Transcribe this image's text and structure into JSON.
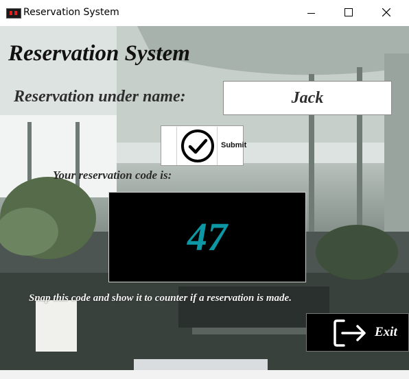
{
  "window": {
    "title": "Reservation System",
    "minimize_icon": "minimize-icon",
    "maximize_icon": "maximize-icon",
    "close_icon": "close-icon"
  },
  "form": {
    "heading": "Reservation System",
    "name_label": "Reservation under name:",
    "name_value": "Jack",
    "submit_label": "Submit",
    "submit_icon": "check-circle-icon",
    "code_label": "Your reservation code is:",
    "code_value": "47",
    "code_color": "#0d96a4",
    "note": "Snap this code and show it to counter if a reservation is made.",
    "exit_label": "Exit",
    "exit_icon": "exit-arrow-icon"
  }
}
